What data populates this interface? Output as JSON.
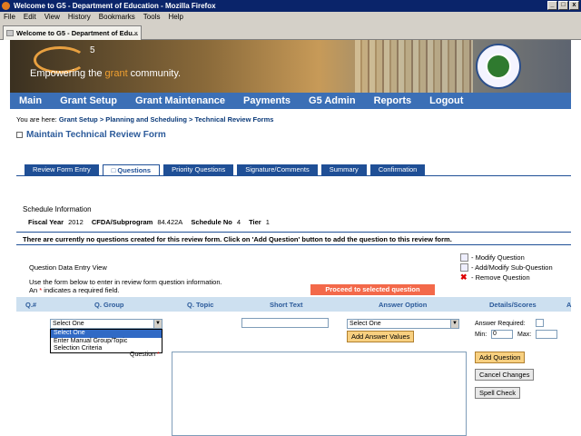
{
  "window": {
    "title": "Welcome to G5 - Department of Education - Mozilla Firefox"
  },
  "menu": [
    "File",
    "Edit",
    "View",
    "History",
    "Bookmarks",
    "Tools",
    "Help"
  ],
  "browser_tab": {
    "label": "Welcome to G5 - Department of Edu...",
    "close": "×"
  },
  "banner": {
    "logo_text": "5",
    "tagline_pre": "Empowering the ",
    "tagline_accent": "grant",
    "tagline_post": " community."
  },
  "nav": [
    "Main",
    "Grant Setup",
    "Grant Maintenance",
    "Payments",
    "G5 Admin",
    "Reports",
    "Logout"
  ],
  "breadcrumb": {
    "prefix": "You are here: ",
    "path": "Grant Setup > Planning and Scheduling > Technical Review Forms"
  },
  "page_title": "Maintain Technical Review Form",
  "form_tabs": [
    "Review Form Entry",
    "Questions",
    "Priority Questions",
    "Signature/Comments",
    "Summary",
    "Confirmation"
  ],
  "schedule": {
    "heading": "Schedule Information",
    "fiscal_year_label": "Fiscal Year",
    "fiscal_year": "2012",
    "cfda_label": "CFDA/Subprogram",
    "cfda": "84.422A",
    "schedule_label": "Schedule No",
    "schedule_no": "4",
    "tier_label": "Tier",
    "tier": "1"
  },
  "notice": "There are currently no questions created for this review form. Click on 'Add Question' button to add the question to this review form.",
  "legend": {
    "modify": "- Modify Question",
    "add_sub": "- Add/Modify Sub-Question",
    "remove": "- Remove Question"
  },
  "question_view": "Question Data Entry View",
  "instructions": {
    "line1": "Use the form below to enter in review form question information.",
    "line2_pre": "An ",
    "star": "*",
    "line2_post": " indicates a required field."
  },
  "proceed_label": "Proceed to selected question",
  "columns": [
    "Q.#",
    "Q. Group",
    "Q. Topic",
    "Short Text",
    "Answer Option",
    "Details/Scores",
    "A"
  ],
  "group_select": {
    "value": "Select One",
    "options": [
      "Select One",
      "Enter Manual Group/Topic",
      "Selection Criteria"
    ]
  },
  "answer_select": {
    "value": "Select One"
  },
  "add_answer_values": "Add Answer Values",
  "details": {
    "answer_required": "Answer Required:",
    "min_label": "Min:",
    "min_value": "0",
    "max_label": "Max:"
  },
  "question_label": "Question",
  "buttons": {
    "add_question": "Add Question",
    "cancel_changes": "Cancel Changes",
    "spell_check": "Spell Check"
  }
}
